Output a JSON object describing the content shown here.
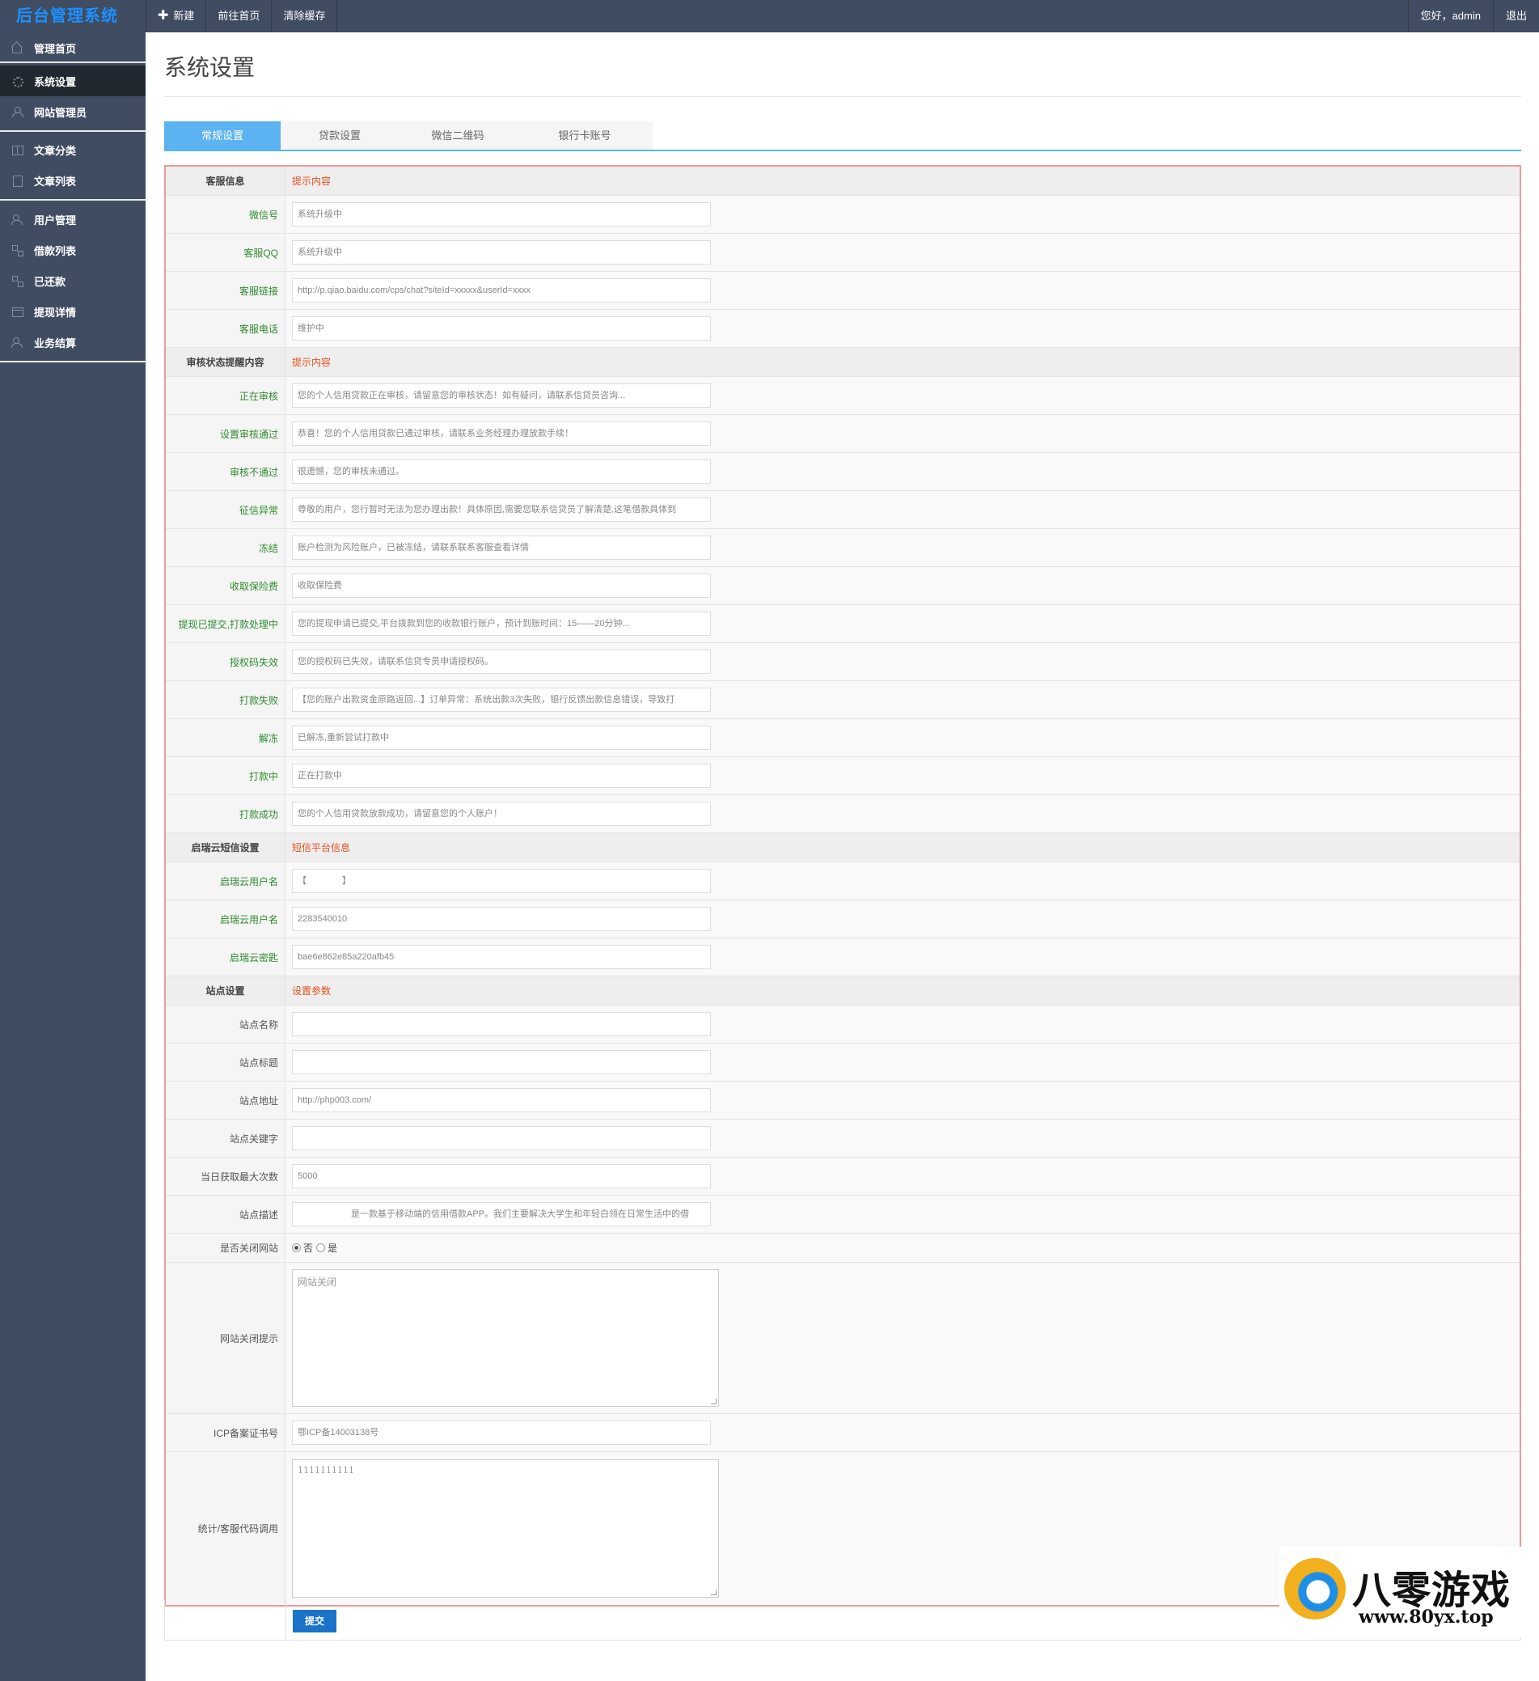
{
  "app": {
    "logo": "后台管理系统"
  },
  "topnav": [
    {
      "label": "新建",
      "icon": "plus-icon"
    },
    {
      "label": "前往首页"
    },
    {
      "label": "清除缓存"
    }
  ],
  "topright": {
    "greeting": "您好，admin",
    "logout": "退出"
  },
  "sidebar": {
    "items": [
      {
        "label": "管理首页",
        "icon": "home-icon"
      },
      {
        "label": "系统设置",
        "icon": "gear-icon",
        "active": true
      },
      {
        "label": "网站管理员",
        "icon": "user-icon"
      },
      {
        "label": "文章分类",
        "icon": "book-icon"
      },
      {
        "label": "文章列表",
        "icon": "file-icon"
      },
      {
        "label": "用户管理",
        "icon": "users-icon"
      },
      {
        "label": "借款列表",
        "icon": "grid-icon"
      },
      {
        "label": "已还款",
        "icon": "grid-icon"
      },
      {
        "label": "提现详情",
        "icon": "card-icon"
      },
      {
        "label": "业务结算",
        "icon": "users-icon"
      }
    ]
  },
  "page": {
    "title": "系统设置"
  },
  "tabs": [
    {
      "label": "常规设置",
      "active": true
    },
    {
      "label": "贷款设置"
    },
    {
      "label": "微信二维码"
    },
    {
      "label": "银行卡账号"
    }
  ],
  "form": {
    "section_kefu": {
      "label": "客服信息",
      "hint": "提示内容"
    },
    "wechat": {
      "label": "微信号",
      "value": "系统升级中"
    },
    "qq": {
      "label": "客服QQ",
      "value": "系统升级中"
    },
    "kefu_link": {
      "label": "客服链接",
      "value": "http://p.qiao.baidu.com/cps/chat?siteId=xxxxx&userId=xxxx"
    },
    "kefu_phone": {
      "label": "客服电话",
      "value": "维护中"
    },
    "section_status": {
      "label": "审核状态提醒内容",
      "hint": "提示内容"
    },
    "reviewing": {
      "label": "正在审核",
      "value": "您的个人信用贷款正在审核，请留意您的审核状态！如有疑问，请联系信贷员咨询..."
    },
    "approved": {
      "label": "设置审核通过",
      "value": "恭喜！您的个人信用贷款已通过审核，请联系业务经理办理放款手续！"
    },
    "rejected": {
      "label": "审核不通过",
      "value": "很遗憾，您的审核未通过。"
    },
    "credit_abnormal": {
      "label": "征信异常",
      "value": "尊敬的用户，您行暂时无法为您办理出款！具体原因,需要您联系信贷员了解清楚,这笔借款具体到"
    },
    "frozen": {
      "label": "冻结",
      "value": "账户检测为风险账户，已被冻结，请联系联系客服查看详情"
    },
    "insurance": {
      "label": "收取保险费",
      "value": "收取保险费"
    },
    "withdraw_processing": {
      "label": "提现已提交,打款处理中",
      "value": "您的提现申请已提交,平台拨款到您的收款银行账户，预计到账时间：15——20分钟..."
    },
    "auth_invalid": {
      "label": "授权码失效",
      "value": "您的授权码已失效，请联系信贷专员申请授权码。"
    },
    "pay_failed": {
      "label": "打款失败",
      "value": "【您的账户出款资金原路返回...】订单异常：系统出款3次失败，银行反馈出款信息错误，导致打"
    },
    "unfrozen": {
      "label": "解冻",
      "value": "已解冻,重新尝试打款中"
    },
    "paying": {
      "label": "打款中",
      "value": "正在打款中"
    },
    "pay_success": {
      "label": "打款成功",
      "value": "您的个人信用贷款放款成功，请留意您的个人账户！"
    },
    "section_sms": {
      "label": "启瑞云短信设置",
      "hint": "短信平台信息"
    },
    "sms_user1": {
      "label": "启瑞云用户名",
      "value": "【　　　　】"
    },
    "sms_user2": {
      "label": "启瑞云用户名",
      "value": "2283540010"
    },
    "sms_key": {
      "label": "启瑞云密匙",
      "value": "bae6e862e85a220afb45"
    },
    "section_site": {
      "label": "站点设置",
      "hint": "设置参数"
    },
    "site_name": {
      "label": "站点名称",
      "value": ""
    },
    "site_title": {
      "label": "站点标题",
      "value": ""
    },
    "site_url": {
      "label": "站点地址",
      "value": "http://php003.com/"
    },
    "site_keywords": {
      "label": "站点关键字",
      "value": ""
    },
    "daily_max": {
      "label": "当日获取最大次数",
      "value": "5000"
    },
    "site_desc": {
      "label": "站点描述",
      "value": "　　　　　　是一款基于移动端的信用借款APP。我们主要解决大学生和年轻白领在日常生活中的借"
    },
    "site_closed": {
      "label": "是否关闭网站",
      "opt_no": "否",
      "opt_yes": "是"
    },
    "close_tip": {
      "label": "网站关闭提示",
      "value": "网站关闭"
    },
    "icp": {
      "label": "ICP备案证书号",
      "value": "鄂ICP备14003138号"
    },
    "stat_code": {
      "label": "统计/客服代码调用",
      "value": "1111111111"
    }
  },
  "submit": {
    "label": "提交"
  },
  "watermark": {
    "title": "八零游戏",
    "url": "www.80yx.top"
  }
}
